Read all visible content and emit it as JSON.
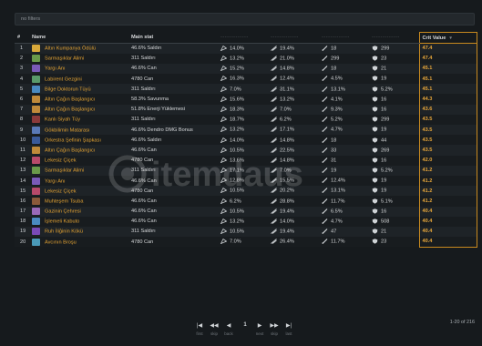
{
  "filter": {
    "placeholder": "no filters"
  },
  "columns": {
    "index": "#",
    "name": "Name",
    "main_stat": "Main stat",
    "dash": "-------------",
    "crit_value": "Crit Value"
  },
  "rows": [
    {
      "n": "1",
      "name": "Altın Kumpanya Ödülü",
      "main": "46.6% Saldırı",
      "s1": "14.0%",
      "s2": "19.4%",
      "s3": "18",
      "s4": "299",
      "crit": "47.4",
      "icon_color": "#d9a93a"
    },
    {
      "n": "2",
      "name": "Sarmaşıklar Alimi",
      "main": "311 Saldırı",
      "s1": "13.2%",
      "s2": "21.0%",
      "s3": "299",
      "s4": "23",
      "crit": "47.4",
      "icon_color": "#6a9a4a"
    },
    {
      "n": "3",
      "name": "Yargı Anı",
      "main": "46.6% Can",
      "s1": "15.2%",
      "s2": "14.8%",
      "s3": "18",
      "s4": "21",
      "crit": "45.1",
      "icon_color": "#7a5ab8"
    },
    {
      "n": "4",
      "name": "Labirent Gezgini",
      "main": "4780 Can",
      "s1": "16.3%",
      "s2": "12.4%",
      "s3": "4.5%",
      "s4": "19",
      "crit": "45.1",
      "icon_color": "#5a9a6a"
    },
    {
      "n": "5",
      "name": "Bilge Doktorun Tüyü",
      "main": "311 Saldırı",
      "s1": "7.0%",
      "s2": "31.1%",
      "s3": "13.1%",
      "s4": "5.2%",
      "crit": "45.1",
      "icon_color": "#4a8ac0"
    },
    {
      "n": "6",
      "name": "Altın Çağın Başlangıcı",
      "main": "58.3% Savunma",
      "s1": "15.6%",
      "s2": "13.2%",
      "s3": "4.1%",
      "s4": "16",
      "crit": "44.3",
      "icon_color": "#c08a3a"
    },
    {
      "n": "7",
      "name": "Altın Çağın Başlangıcı",
      "main": "51.8% Enerji Yüklemesi",
      "s1": "18.3%",
      "s2": "7.0%",
      "s3": "9.3%",
      "s4": "16",
      "crit": "43.6",
      "icon_color": "#c08a3a"
    },
    {
      "n": "8",
      "name": "Kanlı Siyah Tüy",
      "main": "311 Saldırı",
      "s1": "18.7%",
      "s2": "6.2%",
      "s3": "5.2%",
      "s4": "299",
      "crit": "43.5",
      "icon_color": "#8a3a3a"
    },
    {
      "n": "9",
      "name": "Gökbilimin Matarası",
      "main": "46.6% Dendro DMG Bonus",
      "s1": "13.2%",
      "s2": "17.1%",
      "s3": "4.7%",
      "s4": "19",
      "crit": "43.5",
      "icon_color": "#5a7ab8"
    },
    {
      "n": "10",
      "name": "Orkestra Şefinin Şapkası",
      "main": "46.6% Saldırı",
      "s1": "14.0%",
      "s2": "14.8%",
      "s3": "18",
      "s4": "44",
      "crit": "43.5",
      "icon_color": "#3a5a9a"
    },
    {
      "n": "11",
      "name": "Altın Çağın Başlangıcı",
      "main": "46.6% Can",
      "s1": "10.5%",
      "s2": "22.5%",
      "s3": "33",
      "s4": "269",
      "crit": "43.5",
      "icon_color": "#c08a3a"
    },
    {
      "n": "12",
      "name": "Lekesiz Çiçek",
      "main": "4780 Can",
      "s1": "13.6%",
      "s2": "14.8%",
      "s3": "31",
      "s4": "16",
      "crit": "42.0",
      "icon_color": "#b84a6a"
    },
    {
      "n": "13",
      "name": "Sarmaşıklar Alimi",
      "main": "311 Saldırı",
      "s1": "17.1%",
      "s2": "7.0%",
      "s3": "19",
      "s4": "5.2%",
      "crit": "41.2",
      "icon_color": "#6a9a4a"
    },
    {
      "n": "14",
      "name": "Yargı Anı",
      "main": "46.6% Can",
      "s1": "12.8%",
      "s2": "15.5%",
      "s3": "12.4%",
      "s4": "19",
      "crit": "41.2",
      "icon_color": "#7a5ab8"
    },
    {
      "n": "15",
      "name": "Lekesiz Çiçek",
      "main": "4780 Can",
      "s1": "10.5%",
      "s2": "20.2%",
      "s3": "13.1%",
      "s4": "19",
      "crit": "41.2",
      "icon_color": "#b84a6a"
    },
    {
      "n": "16",
      "name": "Muhteşem Tsuba",
      "main": "46.6% Can",
      "s1": "6.2%",
      "s2": "28.8%",
      "s3": "11.7%",
      "s4": "5.1%",
      "crit": "41.2",
      "icon_color": "#8a5a3a"
    },
    {
      "n": "17",
      "name": "Gazinin Çehresi",
      "main": "46.6% Can",
      "s1": "10.5%",
      "s2": "19.4%",
      "s3": "6.5%",
      "s4": "16",
      "crit": "40.4",
      "icon_color": "#9a6ab8"
    },
    {
      "n": "18",
      "name": "İşlemeli Kabuto",
      "main": "46.6% Can",
      "s1": "13.2%",
      "s2": "14.0%",
      "s3": "4.7%",
      "s4": "508",
      "crit": "40.4",
      "icon_color": "#4a8ac0"
    },
    {
      "n": "19",
      "name": "Ruh İliğinin Kökü",
      "main": "311 Saldırı",
      "s1": "10.5%",
      "s2": "19.4%",
      "s3": "47",
      "s4": "21",
      "crit": "40.4",
      "icon_color": "#7a4ab8"
    },
    {
      "n": "20",
      "name": "Avcının Broşu",
      "main": "4780 Can",
      "s1": "7.0%",
      "s2": "26.4%",
      "s3": "11.7%",
      "s4": "23",
      "crit": "40.4",
      "icon_color": "#4a9ab8"
    }
  ],
  "row_icons": [
    {
      "s1": "crit-rate-icon",
      "s2": "crit-dmg-icon",
      "s3": "attack-icon",
      "s4": "defense-icon"
    }
  ],
  "pagination": {
    "first": "|◀",
    "skip_back": "◀◀",
    "back": "◀",
    "current": "1",
    "next": "▶",
    "skip_next": "▶▶",
    "last": "▶|",
    "labels": {
      "first": "first",
      "skip_back": "skip",
      "back": "back",
      "next": "next",
      "skip_next": "skip",
      "last": "last"
    },
    "total": "1-20 of 216"
  },
  "watermark": "itemdaus",
  "colors": {
    "accent": "#e2a233",
    "crit_border": "#c98a1f",
    "background": "#161a1d"
  }
}
